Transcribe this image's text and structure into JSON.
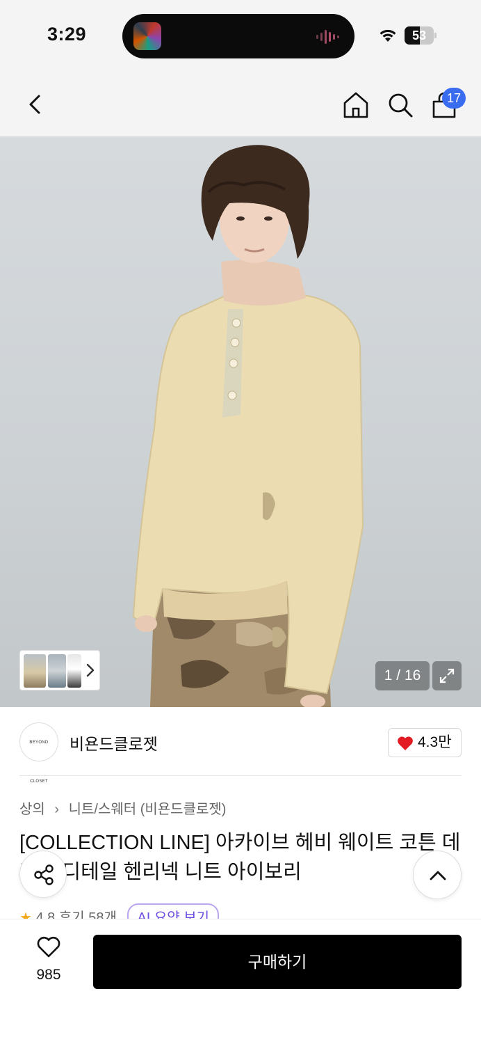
{
  "status_bar": {
    "time": "3:29",
    "battery": "53",
    "battery_level": 0.53,
    "icons": [
      "wifi-icon",
      "battery-icon"
    ]
  },
  "header": {
    "icons": [
      "back-icon",
      "home-icon",
      "search-icon",
      "cart-icon"
    ],
    "cart_badge": "17",
    "badge_color": "#3a6cf0"
  },
  "gallery": {
    "counter": "1 / 16"
  },
  "brand": {
    "logo_text": "BEYOND CLOSET",
    "name": "비욘드클로젯",
    "likes": "4.3만"
  },
  "product": {
    "breadcrumb": [
      "상의",
      "니트/스웨터 (비욘드클로젯)"
    ],
    "title": "[COLLECTION LINE] 아카이브 헤비 웨이트 코튼 데미지 디테일 헨리넥 니트 아이보리",
    "rating": "4.8",
    "reviews": "후기 58개",
    "ai_label": "AI 요약 보기"
  },
  "bottom_bar": {
    "wish_count": "985",
    "buy_label": "구매하기"
  },
  "colors": {
    "accent_heart": "#e31b23",
    "buy_button": "#000000",
    "star": "#f2a91e"
  }
}
